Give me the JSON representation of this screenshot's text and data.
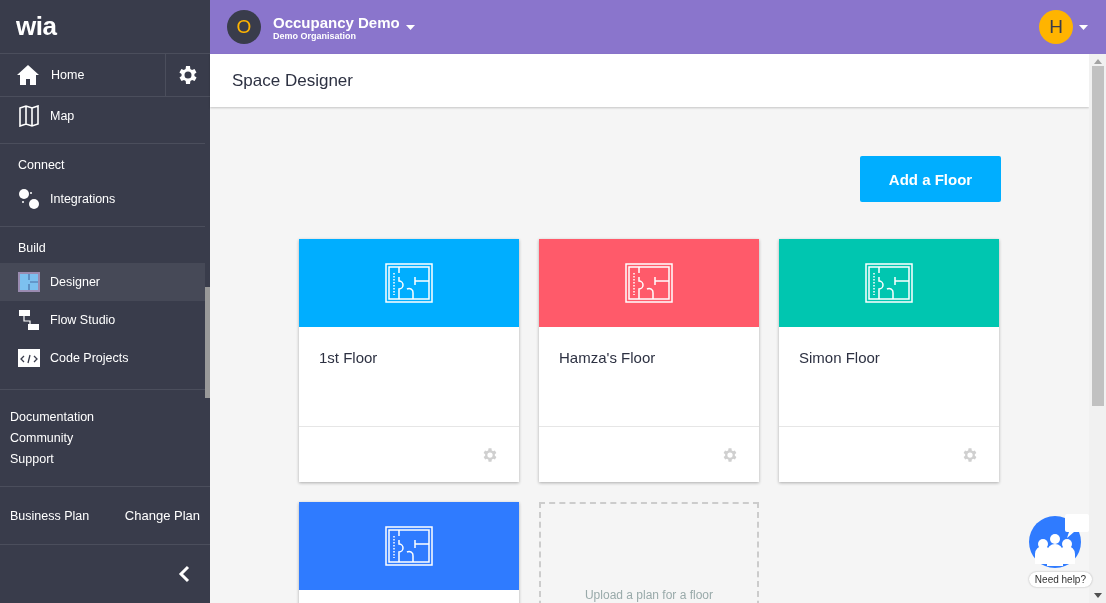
{
  "sidebar": {
    "logo": "wia",
    "home": {
      "label": "Home",
      "selected": false
    },
    "items": [
      {
        "kind": "link",
        "label": "Map",
        "selected": false
      },
      {
        "kind": "heading",
        "label": "Connect"
      },
      {
        "kind": "link",
        "label": "Integrations",
        "selected": false
      },
      {
        "kind": "heading",
        "label": "Build"
      },
      {
        "kind": "link",
        "label": "Designer",
        "selected": true
      },
      {
        "kind": "link",
        "label": "Flow Studio",
        "selected": false
      },
      {
        "kind": "link",
        "label": "Code Projects",
        "selected": false
      }
    ],
    "links": [
      "Documentation",
      "Community",
      "Support"
    ],
    "plan": {
      "name": "Business Plan",
      "action": "Change Plan"
    }
  },
  "topbar": {
    "org_initial": "O",
    "title": "Occupancy Demo",
    "subtitle": "Demo Organisation",
    "user_initial": "H"
  },
  "page": {
    "title": "Space Designer",
    "add_button": "Add a Floor",
    "floors": [
      {
        "name": "1st Floor",
        "color": "#00aeff"
      },
      {
        "name": "Hamza's Floor",
        "color": "#ff5a6a"
      },
      {
        "name": "Simon Floor",
        "color": "#00c6b0"
      },
      {
        "color": "#2f7bff"
      }
    ],
    "upload": "Upload a plan for a floor"
  },
  "help": "Need help?"
}
